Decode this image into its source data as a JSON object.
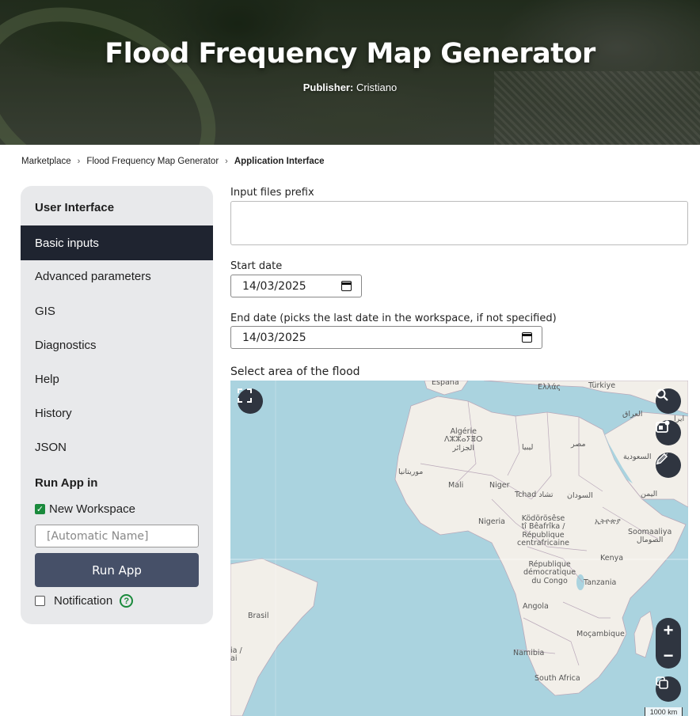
{
  "hero": {
    "title": "Flood Frequency Map Generator",
    "publisher_label": "Publisher:",
    "publisher_name": "Cristiano"
  },
  "breadcrumb": {
    "items": [
      "Marketplace",
      "Flood Frequency Map Generator"
    ],
    "current": "Application Interface"
  },
  "sidebar": {
    "heading": "User Interface",
    "items": [
      {
        "label": "Basic inputs",
        "active": true
      },
      {
        "label": "Advanced parameters"
      },
      {
        "label": "GIS"
      },
      {
        "label": "Diagnostics"
      },
      {
        "label": "Help"
      },
      {
        "label": "History"
      },
      {
        "label": "JSON"
      }
    ],
    "run_heading": "Run App in",
    "new_workspace_label": "New Workspace",
    "new_workspace_checked": true,
    "workspace_name_placeholder": "[Automatic Name]",
    "run_button": "Run App",
    "notification_label": "Notification",
    "notification_checked": false,
    "help_glyph": "?"
  },
  "form": {
    "prefix_label": "Input files prefix",
    "prefix_value": "",
    "start_label": "Start date",
    "start_value": "14/03/2025",
    "end_label": "End date (picks the last date in the workspace, if not specified)",
    "end_value": "14/03/2025",
    "map_label": "Select area of the flood"
  },
  "map": {
    "labels": {
      "espana": "España",
      "ellas": "Ελλάς",
      "turkiye": "Türkiye",
      "iraq": "العراق",
      "iran": "ایرا",
      "algerie": "Algérie\nⴷⵣⵣⴰⵢⴻⵔ\nالجزائر",
      "libya": "ليبيا",
      "misr": "مصر",
      "saudi": "السعودية",
      "mauritania": "موريتانيا",
      "mali": "Mali",
      "niger": "Niger",
      "tchad": "Tchad تشاد",
      "sudan": "السودان",
      "yemen": "اليمن",
      "nigeria": "Nigeria",
      "car": "Ködörösêse\ntî Bêafrîka /\nRépublique\ncentrafricaine",
      "ethiopia": "ኢትዮጵያ",
      "somalia": "Soomaaliya\nالصومال",
      "kenya": "Kenya",
      "drc": "République\ndémocratique\ndu Congo",
      "tanzania": "Tanzania",
      "brasil": "Brasil",
      "angola": "Angola",
      "mozambique": "Moçambique",
      "namibia": "Namibia",
      "south_africa": "South Africa",
      "edge_ia": "ia /\nai"
    },
    "scale": "1000 km",
    "zoom_in": "+",
    "zoom_out": "−",
    "colors": {
      "water": "#aad3df",
      "land": "#f2efe9",
      "border": "#b9a8b9",
      "control": "#2f3540"
    }
  }
}
